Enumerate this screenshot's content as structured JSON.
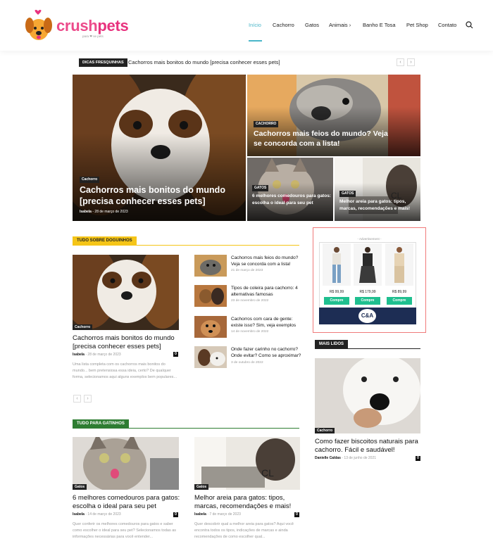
{
  "header": {
    "logo": {
      "text_a": "crush",
      "text_b": "pets",
      "tagline": "para ❤ se pets"
    },
    "nav": [
      "Início",
      "Cachorro",
      "Gatos",
      "Animais",
      "Banho E Tosa",
      "Pet Shop",
      "Contato"
    ],
    "nav_chevron": "›",
    "search_icon": "search-icon"
  },
  "ticker": {
    "label": "DICAS FRESQUINHAS",
    "text": "Cachorros mais bonitos do mundo [precisa conhecer esses pets]",
    "prev": "‹",
    "next": "›"
  },
  "hero": {
    "main": {
      "category": "Cachorro",
      "title": "Cachorros mais bonitos do mundo [precisa conhecer esses pets]",
      "author": "Isabela",
      "date": "28 de março de 2023"
    },
    "top_right": {
      "category": "CACHORRO",
      "title": "Cachorros mais feios do mundo? Veja se concorda com a lista!"
    },
    "bottom_left": {
      "category": "GATOS",
      "title": "6 melhores comedouros para gatos: escolha o ideal para seu pet"
    },
    "bottom_right": {
      "category": "GATOS",
      "title": "Melhor areia para gatos: tipos, marcas, recomendações e mais!"
    }
  },
  "dogs_section": {
    "tag": "TUDO SOBRE DOGUINHOS",
    "feature": {
      "category": "Cachorro",
      "title": "Cachorros mais bonitos do mundo [precisa conhecer esses pets]",
      "author": "Isabela",
      "date": "- 28 de março de 2023",
      "comments": "0",
      "excerpt": "Uma lista completa com os cachorros mais bonitos do mundo... bem pretensiosa essa ideia, certo? De qualquer forma, selecionamos aqui alguns exemplos bem populares..."
    },
    "list": [
      {
        "title": "Cachorros mais feios do mundo? Veja se concorda com a lista!",
        "date": "21 de março de 2023"
      },
      {
        "title": "Tipos de coleira para cachorro: 4 alternativas famosas",
        "date": "23 de novembro de 2022"
      },
      {
        "title": "Cachorros com cara de gente: existe isso? Sim, veja exemplos",
        "date": "14 de novembro de 2022"
      },
      {
        "title": "Onde fazer carinho no cachorro? Onde evitar? Como se aproximar?",
        "date": "3 de outubro de 2022"
      }
    ],
    "prev": "‹",
    "next": "›"
  },
  "cats_section": {
    "tag": "TUDO PARA GATINHOS",
    "posts": [
      {
        "category": "Gatos",
        "title": "6 melhores comedouros para gatos: escolha o ideal para seu pet",
        "author": "Isabela",
        "date": "- 14 de março de 2023",
        "comments": "0",
        "excerpt": "Quer conferir os melhores comedouros para gatos e saber como escolher o ideal para seu pet? Selecionamos todas as informações necessárias para você entender..."
      },
      {
        "category": "Gatos",
        "title": "Melhor areia para gatos: tipos, marcas, recomendações e mais!",
        "author": "Isabela",
        "date": "- 7 de março de 2023",
        "comments": "0",
        "excerpt": "Quer descobrir qual a melhor areia para gatos? Aqui você encontra todos os tipos, indicações de marcas e ainda recomendações de como escolher qual..."
      }
    ]
  },
  "ad": {
    "label": "- Advertisement -",
    "prices": [
      "R$ 99,99",
      "R$ 179,99",
      "R$ 89,99"
    ],
    "button": "Compre",
    "brand": "C&A"
  },
  "most_read": {
    "tag": "MAIS LIDOS",
    "post": {
      "category": "Cachorro",
      "title": "Como fazer biscoitos naturais para cachorro. Fácil e saudável!",
      "author": "Danielle Caldas",
      "date": "- 13 de junho de 2021",
      "comments": "0"
    }
  },
  "colors": {
    "accent": "#4ab6c9",
    "pink": "#e8327e",
    "dogs_tag": "#f5c518",
    "cats_tag": "#2e7d32",
    "buy": "#1fbf8f",
    "ad_border": "#f07a7a"
  }
}
